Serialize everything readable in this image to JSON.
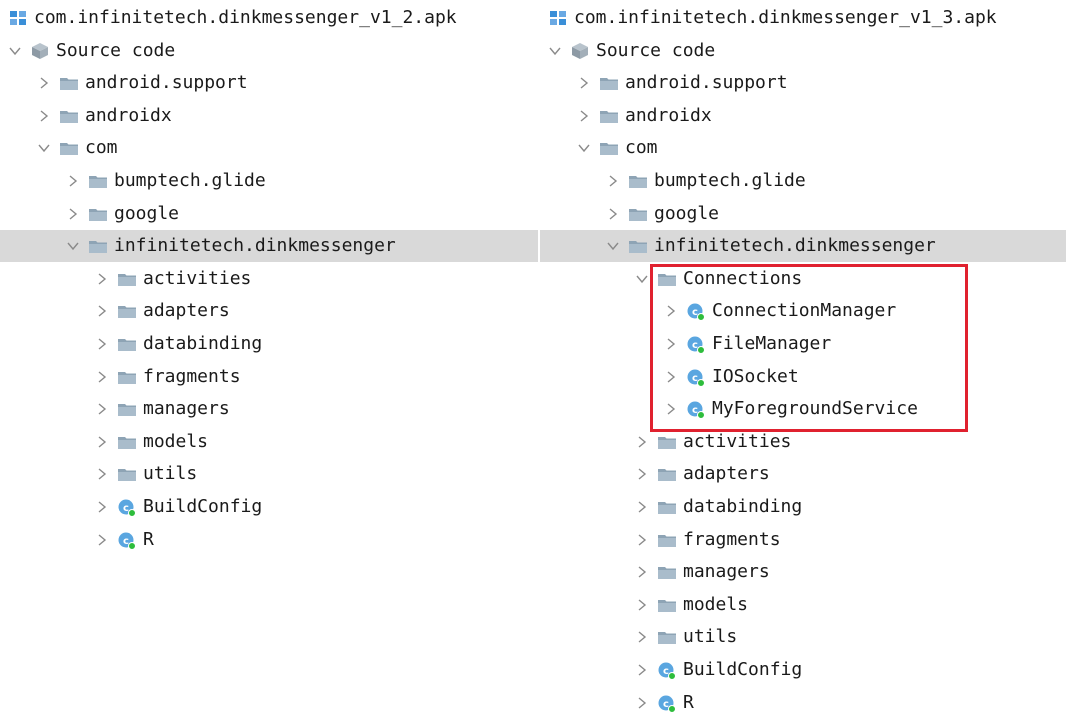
{
  "colors": {
    "selected_row": "#d9d9d9",
    "highlight_border": "#e0212f",
    "folder": "#8ea4b5",
    "class_icon": "#5aa6e0",
    "class_dot": "#2ebd3c",
    "apk_icon": "#3a8fd8",
    "chevron": "#8a8a8a"
  },
  "trees": [
    {
      "name": "left",
      "rows": [
        {
          "depth": 0,
          "expander": "none",
          "icon": "apk-icon",
          "label": "com.infinitetech.dinkmessenger_v1_2.apk"
        },
        {
          "depth": 0,
          "expander": "open",
          "icon": "source-icon",
          "label": "Source code"
        },
        {
          "depth": 1,
          "expander": "closed",
          "icon": "folder-icon",
          "label": "android.support"
        },
        {
          "depth": 1,
          "expander": "closed",
          "icon": "folder-icon",
          "label": "androidx"
        },
        {
          "depth": 1,
          "expander": "open",
          "icon": "folder-icon",
          "label": "com"
        },
        {
          "depth": 2,
          "expander": "closed",
          "icon": "folder-icon",
          "label": "bumptech.glide"
        },
        {
          "depth": 2,
          "expander": "closed",
          "icon": "folder-icon",
          "label": "google"
        },
        {
          "depth": 2,
          "expander": "open",
          "icon": "folder-icon",
          "label": "infinitetech.dinkmessenger",
          "selected": true
        },
        {
          "depth": 3,
          "expander": "closed",
          "icon": "folder-icon",
          "label": "activities"
        },
        {
          "depth": 3,
          "expander": "closed",
          "icon": "folder-icon",
          "label": "adapters"
        },
        {
          "depth": 3,
          "expander": "closed",
          "icon": "folder-icon",
          "label": "databinding"
        },
        {
          "depth": 3,
          "expander": "closed",
          "icon": "folder-icon",
          "label": "fragments"
        },
        {
          "depth": 3,
          "expander": "closed",
          "icon": "folder-icon",
          "label": "managers"
        },
        {
          "depth": 3,
          "expander": "closed",
          "icon": "folder-icon",
          "label": "models"
        },
        {
          "depth": 3,
          "expander": "closed",
          "icon": "folder-icon",
          "label": "utils"
        },
        {
          "depth": 3,
          "expander": "closed",
          "icon": "class-icon",
          "label": "BuildConfig"
        },
        {
          "depth": 3,
          "expander": "closed",
          "icon": "class-icon",
          "label": "R"
        }
      ]
    },
    {
      "name": "right",
      "rows": [
        {
          "depth": 0,
          "expander": "none",
          "icon": "apk-icon",
          "label": "com.infinitetech.dinkmessenger_v1_3.apk"
        },
        {
          "depth": 0,
          "expander": "open",
          "icon": "source-icon",
          "label": "Source code"
        },
        {
          "depth": 1,
          "expander": "closed",
          "icon": "folder-icon",
          "label": "android.support"
        },
        {
          "depth": 1,
          "expander": "closed",
          "icon": "folder-icon",
          "label": "androidx"
        },
        {
          "depth": 1,
          "expander": "open",
          "icon": "folder-icon",
          "label": "com"
        },
        {
          "depth": 2,
          "expander": "closed",
          "icon": "folder-icon",
          "label": "bumptech.glide"
        },
        {
          "depth": 2,
          "expander": "closed",
          "icon": "folder-icon",
          "label": "google"
        },
        {
          "depth": 2,
          "expander": "open",
          "icon": "folder-icon",
          "label": "infinitetech.dinkmessenger",
          "selected": true
        },
        {
          "depth": 3,
          "expander": "open",
          "icon": "folder-icon",
          "label": "Connections"
        },
        {
          "depth": 4,
          "expander": "closed",
          "icon": "class-icon",
          "label": "ConnectionManager"
        },
        {
          "depth": 4,
          "expander": "closed",
          "icon": "class-icon",
          "label": "FileManager"
        },
        {
          "depth": 4,
          "expander": "closed",
          "icon": "class-icon",
          "label": "IOSocket"
        },
        {
          "depth": 4,
          "expander": "closed",
          "icon": "class-icon",
          "label": "MyForegroundService"
        },
        {
          "depth": 3,
          "expander": "closed",
          "icon": "folder-icon",
          "label": "activities"
        },
        {
          "depth": 3,
          "expander": "closed",
          "icon": "folder-icon",
          "label": "adapters"
        },
        {
          "depth": 3,
          "expander": "closed",
          "icon": "folder-icon",
          "label": "databinding"
        },
        {
          "depth": 3,
          "expander": "closed",
          "icon": "folder-icon",
          "label": "fragments"
        },
        {
          "depth": 3,
          "expander": "closed",
          "icon": "folder-icon",
          "label": "managers"
        },
        {
          "depth": 3,
          "expander": "closed",
          "icon": "folder-icon",
          "label": "models"
        },
        {
          "depth": 3,
          "expander": "closed",
          "icon": "folder-icon",
          "label": "utils"
        },
        {
          "depth": 3,
          "expander": "closed",
          "icon": "class-icon",
          "label": "BuildConfig"
        },
        {
          "depth": 3,
          "expander": "closed",
          "icon": "class-icon",
          "label": "R"
        }
      ]
    }
  ]
}
